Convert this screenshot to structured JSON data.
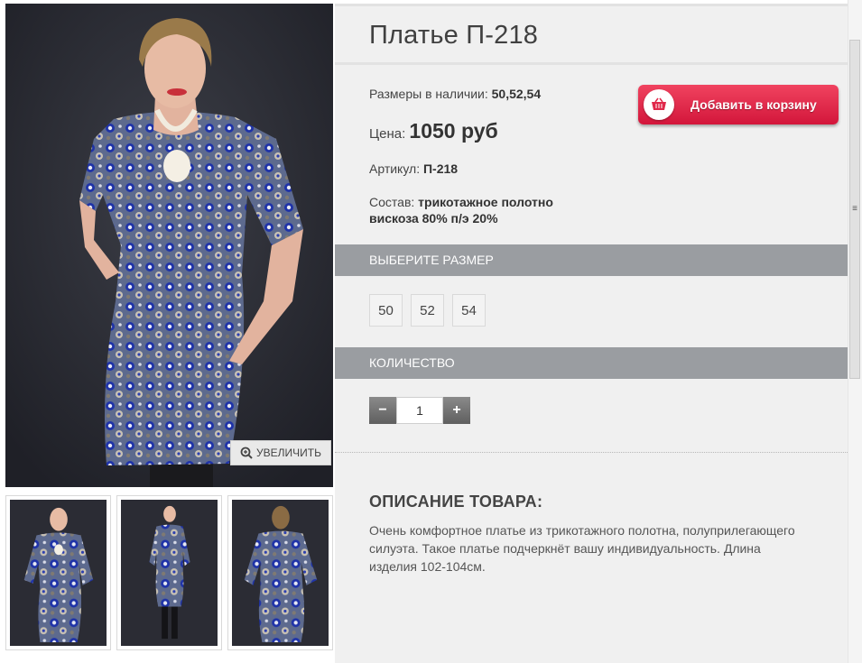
{
  "product": {
    "title": "Платье П-218",
    "sizes_label": "Размеры в наличии:",
    "sizes_value": "50,52,54",
    "price_label": "Цена:",
    "price_value": "1050 руб",
    "sku_label": "Артикул:",
    "sku_value": "П-218",
    "composition_label": "Состав:",
    "composition_line1": "трикотажное полотно",
    "composition_line2": "вискоза 80% п/э 20%"
  },
  "cart_button": {
    "label": "Добавить в корзину",
    "icon": "basket-icon",
    "color": "#e0284a"
  },
  "size_section": {
    "heading": "ВЫБЕРИТЕ РАЗМЕР",
    "options": [
      "50",
      "52",
      "54"
    ]
  },
  "quantity_section": {
    "heading": "КОЛИЧЕСТВО",
    "value": "1",
    "minus": "−",
    "plus": "+"
  },
  "gallery": {
    "zoom_label": "УВЕЛИЧИТЬ",
    "zoom_icon": "magnifier-plus-icon"
  },
  "description": {
    "heading": "ОПИСАНИЕ ТОВАРА:",
    "text": "Очень комфортное платье из трикотажного полотна, полуприлегающего силуэта. Такое платье подчеркнёт вашу индивидуальность. Длина изделия 102-104см."
  },
  "colors": {
    "section_bar": "#9a9da1",
    "panel_bg": "#f0f0f0",
    "photo_bg": "#2a2b33",
    "dress_blue": "#2a3fa3"
  }
}
